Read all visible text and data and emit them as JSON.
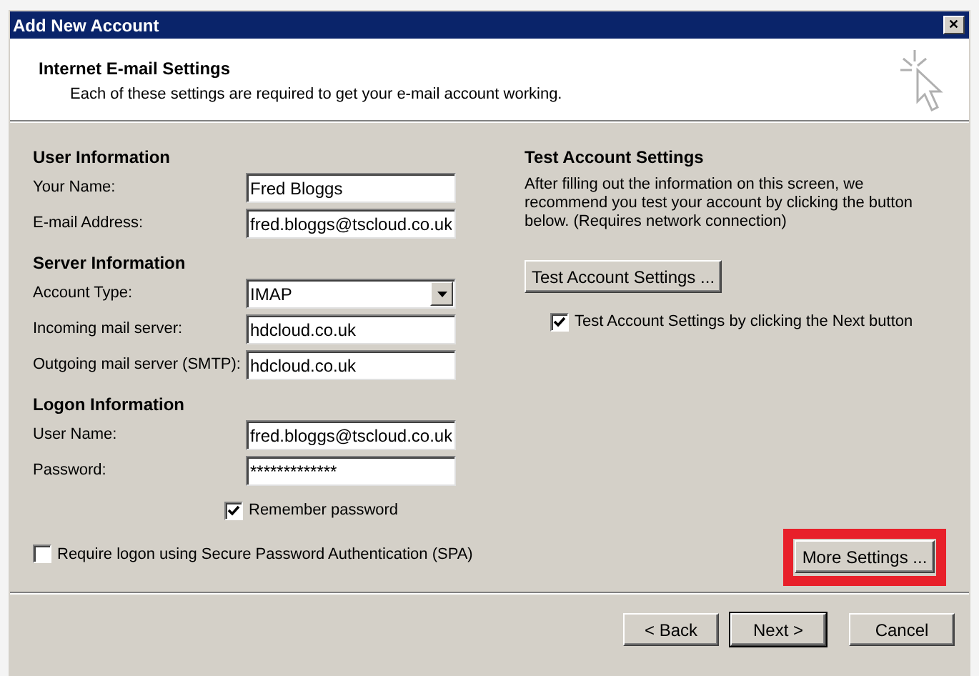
{
  "window": {
    "title": "Add New Account",
    "close": "✕"
  },
  "header": {
    "title": "Internet E-mail Settings",
    "subtitle": "Each of these settings are required to get your e-mail account working."
  },
  "groups": [
    {
      "heading": "User Information",
      "fields": [
        {
          "label": "Your Name:",
          "value": "Fred Bloggs",
          "kind": "text"
        },
        {
          "label": "E-mail Address:",
          "value": "fred.bloggs@tscloud.co.uk",
          "kind": "text"
        }
      ]
    },
    {
      "heading": "Server Information",
      "fields": [
        {
          "label": "Account Type:",
          "value": "IMAP",
          "kind": "dropdown"
        },
        {
          "label": "Incoming mail server:",
          "value": "hdcloud.co.uk",
          "kind": "text"
        },
        {
          "label": "Outgoing mail server (SMTP):",
          "value": "hdcloud.co.uk",
          "kind": "text"
        }
      ]
    },
    {
      "heading": "Logon Information",
      "fields": [
        {
          "label": "User Name:",
          "value": "fred.bloggs@tscloud.co.uk",
          "kind": "text"
        },
        {
          "label": "Password:",
          "value": "*************",
          "kind": "password"
        }
      ]
    }
  ],
  "remember_password": {
    "label": "Remember password",
    "checked": true
  },
  "spa": {
    "label": "Require logon using Secure Password Authentication (SPA)",
    "checked": false
  },
  "test": {
    "title": "Test Account Settings",
    "description": "After filling out the information on this screen, we recommend you test your account by clicking the button below. (Requires network connection)",
    "button": "Test Account Settings ...",
    "checkbox": {
      "label": "Test Account Settings by clicking the Next button",
      "checked": true
    }
  },
  "more_settings": {
    "label": "More Settings ...",
    "highlighted": true
  },
  "footer_buttons": [
    {
      "label": "< Back",
      "default": false
    },
    {
      "label": "Next >",
      "default": true
    },
    {
      "label": "Cancel",
      "default": false
    }
  ]
}
